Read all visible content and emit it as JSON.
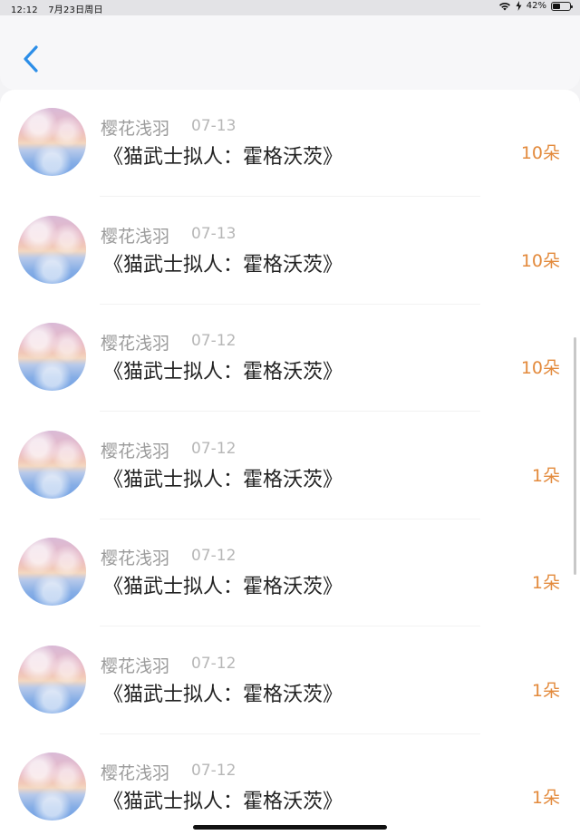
{
  "status_bar": {
    "time": "12:12",
    "date": "7月23日周日",
    "battery": "42%",
    "battery_level": 0.42
  },
  "nav": {
    "back_icon": "chevron-left-icon",
    "accent": "#2c8ee8"
  },
  "list": [
    {
      "name": "樱花浅羽",
      "date": "07-13",
      "title": "《猫武士拟人：霍格沃茨》",
      "amount": "10朵"
    },
    {
      "name": "樱花浅羽",
      "date": "07-13",
      "title": "《猫武士拟人：霍格沃茨》",
      "amount": "10朵"
    },
    {
      "name": "樱花浅羽",
      "date": "07-12",
      "title": "《猫武士拟人：霍格沃茨》",
      "amount": "10朵"
    },
    {
      "name": "樱花浅羽",
      "date": "07-12",
      "title": "《猫武士拟人：霍格沃茨》",
      "amount": "1朵"
    },
    {
      "name": "樱花浅羽",
      "date": "07-12",
      "title": "《猫武士拟人：霍格沃茨》",
      "amount": "1朵"
    },
    {
      "name": "樱花浅羽",
      "date": "07-12",
      "title": "《猫武士拟人：霍格沃茨》",
      "amount": "1朵"
    },
    {
      "name": "樱花浅羽",
      "date": "07-12",
      "title": "《猫武士拟人：霍格沃茨》",
      "amount": "1朵"
    }
  ],
  "colors": {
    "amount": "#e38a3c",
    "name": "#9b9b9b",
    "date": "#b7b7b7",
    "title": "#222222"
  }
}
